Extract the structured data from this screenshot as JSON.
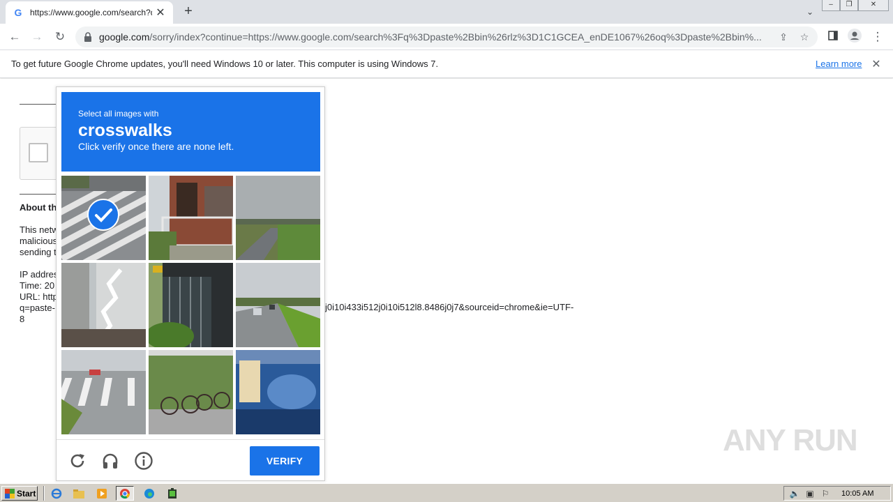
{
  "browser": {
    "tab_title": "https://www.google.com/search?q=",
    "tab_favicon": "G",
    "url_host": "google.com",
    "url_rest": "/sorry/index?continue=https://www.google.com/search%3Fq%3Dpaste%2Bbin%26rlz%3D1C1GCEA_enDE1067%26oq%3Dpaste%2Bbin%..."
  },
  "infobar": {
    "message": "To get future Google Chrome updates, you'll need Windows 10 or later. This computer is using Windows 7.",
    "link": "Learn more"
  },
  "page": {
    "about_title": "About th",
    "about_lines": [
      "This netw",
      "malicious",
      "sending t",
      "",
      "IP addres",
      "Time: 20",
      "URL: http",
      "q=paste-",
      "8"
    ],
    "url_tail": "j0i10i433i512j0i10i512l8.8486j0j7&sourceid=chrome&ie=UTF-"
  },
  "challenge": {
    "prompt_pre": "Select all images with",
    "object": "crosswalks",
    "prompt_post": "Click verify once there are none left.",
    "verify_label": "VERIFY",
    "tiles": [
      {
        "scene": "crosswalk-top-view",
        "selected": true
      },
      {
        "scene": "building-balcony",
        "selected": false
      },
      {
        "scene": "highway-bridge",
        "selected": false
      },
      {
        "scene": "building-stairs",
        "selected": false
      },
      {
        "scene": "gate-plants",
        "selected": false
      },
      {
        "scene": "highway-cars",
        "selected": false
      },
      {
        "scene": "street-crosswalk",
        "selected": false
      },
      {
        "scene": "bicycles",
        "selected": false
      },
      {
        "scene": "truck",
        "selected": false
      }
    ],
    "accent": "#1a73e8"
  },
  "watermark": "ANY RUN",
  "taskbar": {
    "start_label": "Start",
    "clock": "10:05 AM"
  }
}
